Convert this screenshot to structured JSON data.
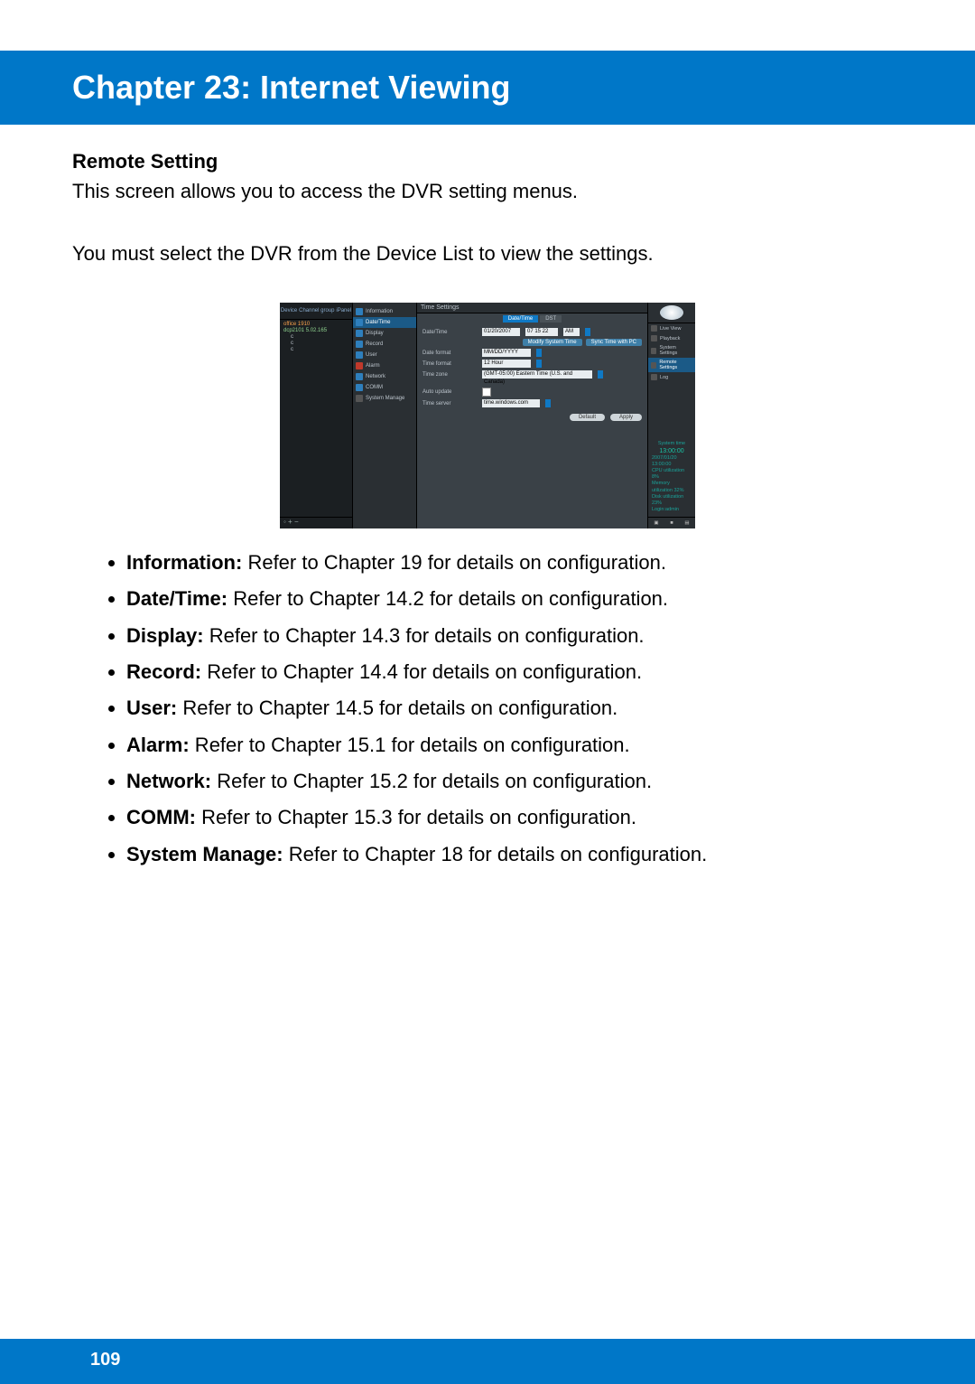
{
  "header": {
    "title": "Chapter 23: Internet Viewing"
  },
  "section": {
    "title": "Remote Setting",
    "intro1": "This screen allows you to access the DVR setting menus.",
    "intro2": "You must select the DVR from the Device List to view the settings."
  },
  "screenshot": {
    "left_tabs": {
      "a": "Device",
      "b": "Channel group",
      "c": "iPanel"
    },
    "tree": {
      "root": "office 1910",
      "device": "dcp2101 5.02.165",
      "channels": [
        "c",
        "c",
        "c"
      ]
    },
    "left_footer": "◦ + −",
    "menu": [
      "Information",
      "Date/Time",
      "Display",
      "Record",
      "User",
      "Alarm",
      "Network",
      "COMM",
      "System Manage"
    ],
    "main": {
      "title": "Time  Settings",
      "tabs": [
        "Date/Time",
        "DST"
      ],
      "rows": {
        "datetime_label": "Date/Time",
        "datetime_date": "01/20/2007",
        "datetime_time": "07  15  22",
        "datetime_ampm": "AM",
        "modify_btn": "Modify System Time",
        "sync_btn": "Sync Time with PC",
        "datefmt_label": "Date format",
        "datefmt_val": "MM/DD/YYYY",
        "timefmt_label": "Time format",
        "timefmt_val": "12 Hour",
        "tz_label": "Time zone",
        "tz_val": "(GMT-05:00) Eastern Time (U.S. and Canada)",
        "auto_label": "Auto update",
        "server_label": "Time server",
        "server_val": "time.windows.com",
        "default_btn": "Default",
        "apply_btn": "Apply"
      }
    },
    "right": {
      "items": [
        "Live View",
        "Playback",
        "System Settings",
        "Remote Settings",
        "Log"
      ],
      "status": {
        "title": "System time",
        "time": "13:00:00",
        "l1": "2007/01/20 13:00:00",
        "l2": "CPU utilization      8%",
        "l3": "Memory utilization   32%",
        "l4": "Disk utilization     23%",
        "l5": "Login:admin"
      }
    }
  },
  "bullets": [
    {
      "term": "Information:",
      "text": " Refer to Chapter 19 for details on configuration."
    },
    {
      "term": "Date/Time:",
      "text": " Refer to Chapter 14.2 for details on configuration."
    },
    {
      "term": "Display:",
      "text": " Refer to Chapter 14.3 for details on configuration."
    },
    {
      "term": "Record:",
      "text": " Refer to Chapter 14.4 for details on configuration."
    },
    {
      "term": "User:",
      "text": " Refer to Chapter 14.5 for details on configuration."
    },
    {
      "term": "Alarm:",
      "text": " Refer to Chapter 15.1 for details on configuration."
    },
    {
      "term": "Network:",
      "text": " Refer to Chapter 15.2 for details on configuration."
    },
    {
      "term": "COMM:",
      "text": " Refer to Chapter 15.3 for details on configuration."
    },
    {
      "term": "System Manage:",
      "text": " Refer to Chapter 18 for details on configuration."
    }
  ],
  "footer": {
    "page": "109"
  }
}
